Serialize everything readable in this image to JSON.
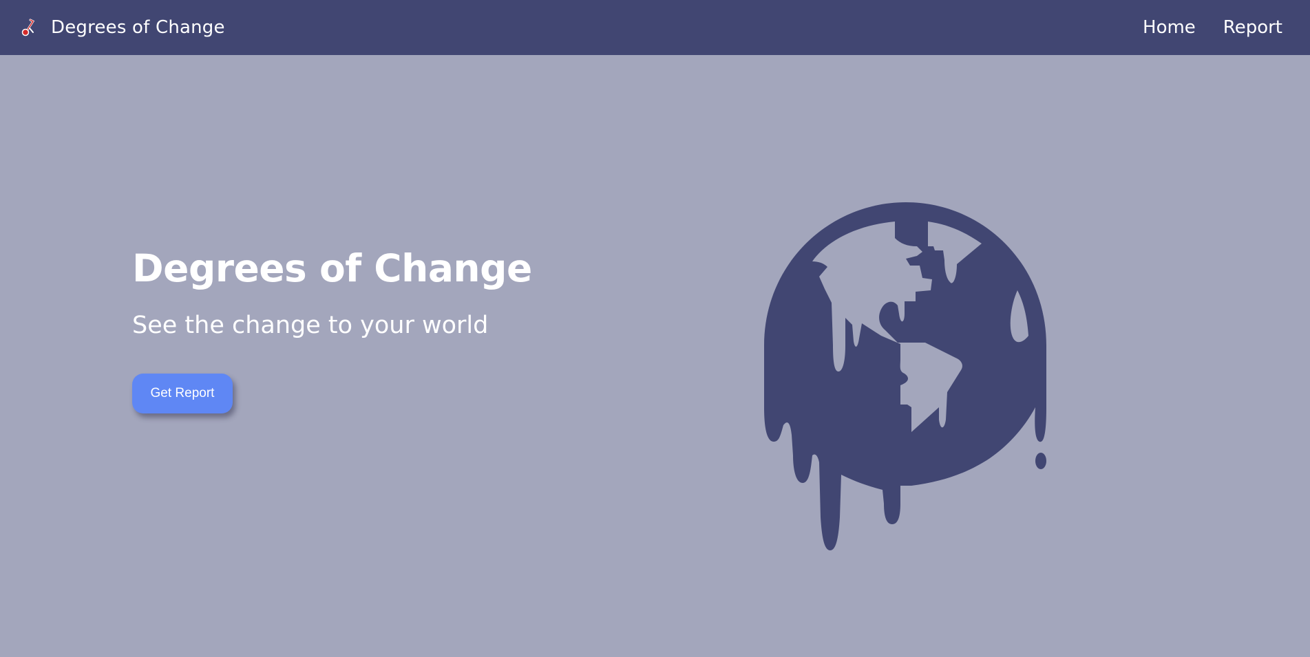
{
  "navbar": {
    "brand_text": "Degrees of Change",
    "brand_icon": "thermometer-icon",
    "links": [
      {
        "label": "Home"
      },
      {
        "label": "Report"
      }
    ]
  },
  "hero": {
    "title": "Degrees of Change",
    "subtitle": "See the change to your world",
    "cta_label": "Get Report",
    "illustration": "melting-globe-icon"
  },
  "colors": {
    "navbar_bg": "#414672",
    "page_bg": "#a3a6bc",
    "globe": "#414672",
    "cta_bg": "#5f87f4",
    "text": "#ffffff",
    "icon_accent": "#d42a2a"
  }
}
